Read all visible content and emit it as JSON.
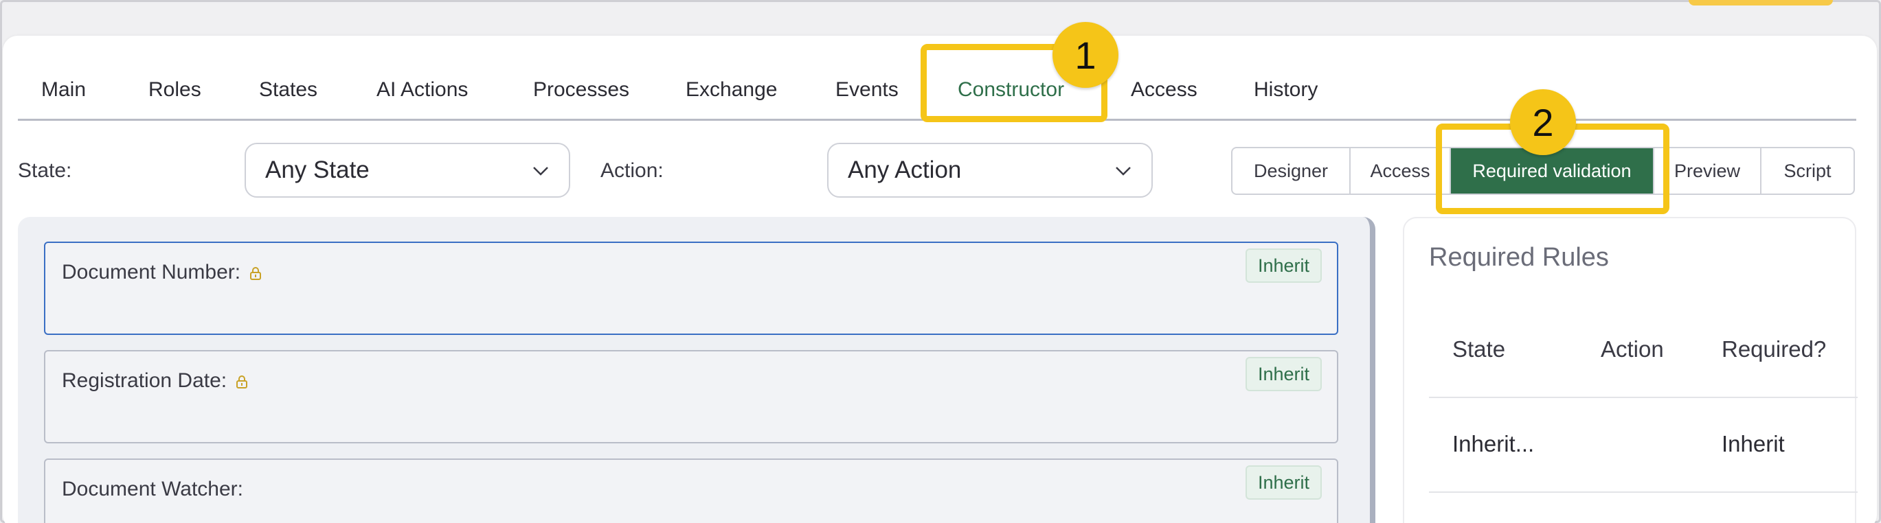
{
  "tabs": [
    {
      "label": "Main"
    },
    {
      "label": "Roles"
    },
    {
      "label": "States"
    },
    {
      "label": "AI Actions"
    },
    {
      "label": "Processes"
    },
    {
      "label": "Exchange"
    },
    {
      "label": "Events"
    },
    {
      "label": "Constructor"
    },
    {
      "label": "Access"
    },
    {
      "label": "History"
    }
  ],
  "active_tab": "Constructor",
  "filters": {
    "state_label": "State:",
    "state_value": "Any State",
    "action_label": "Action:",
    "action_value": "Any Action"
  },
  "view_modes": [
    {
      "label": "Designer"
    },
    {
      "label": "Access"
    },
    {
      "label": "Required validation"
    },
    {
      "label": "Preview"
    },
    {
      "label": "Script"
    }
  ],
  "active_view_mode": "Required validation",
  "fields": [
    {
      "label": "Document Number:",
      "badge": "Inherit",
      "locked": true
    },
    {
      "label": "Registration Date:",
      "badge": "Inherit",
      "locked": true
    },
    {
      "label": "Document Watcher:",
      "badge": "Inherit",
      "locked": false
    }
  ],
  "rules_panel": {
    "title": "Required Rules",
    "columns": [
      "State",
      "Action",
      "Required?"
    ],
    "rows": [
      {
        "state": "Inherit...",
        "action": "",
        "required": "Inherit"
      }
    ]
  },
  "annotations": [
    {
      "number": "1"
    },
    {
      "number": "2"
    }
  ],
  "colors": {
    "accent_green": "#2f6f4a",
    "highlight_yellow": "#f5c518",
    "focus_blue": "#3a6fc4"
  }
}
